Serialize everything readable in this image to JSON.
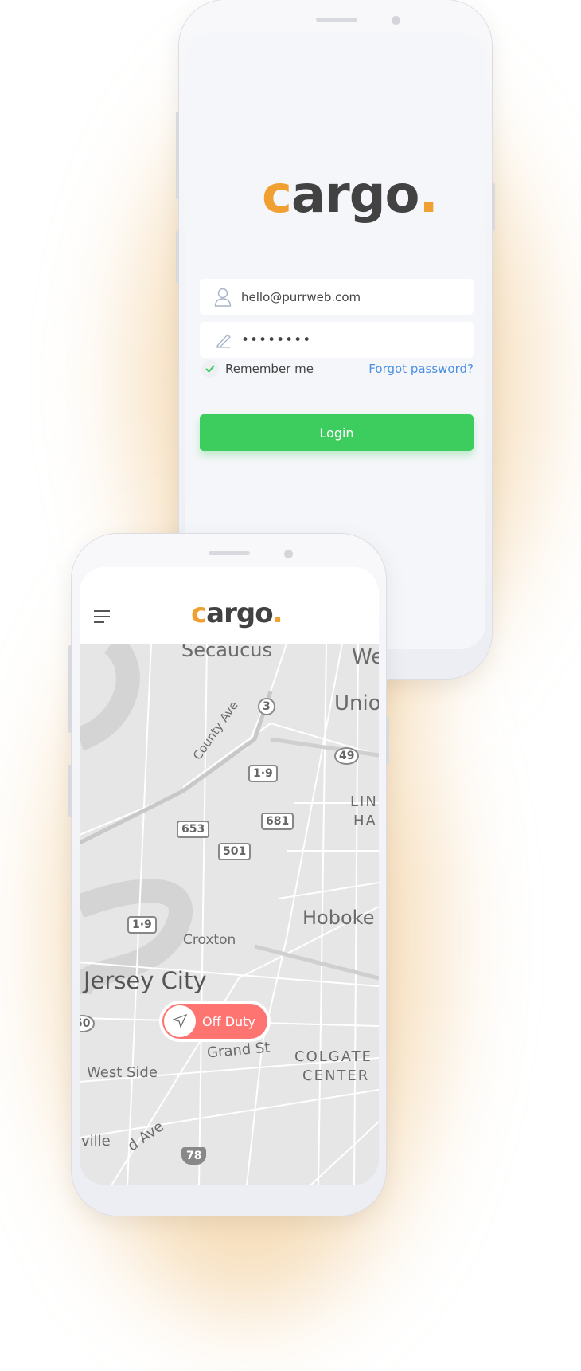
{
  "login_screen": {
    "logo": {
      "main": "c",
      "rest": "argo",
      "dot": "."
    },
    "email_value": "hello@purrweb.com",
    "password_value": "••••••••",
    "remember_label": "Remember me",
    "remember_checked": true,
    "forgot_label": "Forgot password?",
    "login_label": "Login",
    "icons": {
      "email": "user-icon",
      "password": "pen-icon",
      "remember": "check-icon"
    }
  },
  "map_screen": {
    "logo": {
      "main": "c",
      "rest": "argo",
      "dot": "."
    },
    "menu_icon": "hamburger-icon",
    "map_labels": [
      "Secaucus",
      "We",
      "Unio",
      "County Ave",
      "Hoboke",
      "Croxton",
      "Jersey City",
      "Grand St",
      "COLGATE",
      "CENTER",
      "West Side",
      "ville",
      "d Ave",
      "LIN",
      "HA"
    ],
    "route_shields": [
      "3",
      "1·9",
      "49",
      "653",
      "681",
      "501",
      "1·9",
      "50",
      "78"
    ],
    "status_button": {
      "label": "Off Duty",
      "icon": "navigation-arrow-icon"
    }
  },
  "colors": {
    "accent": "#f0a030",
    "login_green": "#3dcc5e",
    "off_duty": "#fe7471",
    "link": "#4a90e2"
  }
}
